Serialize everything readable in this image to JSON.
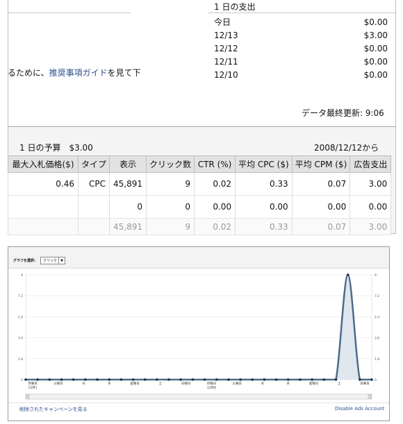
{
  "daily_spend": {
    "title": "1 日の支出",
    "rows": [
      {
        "label": "今日",
        "value": "$0.00"
      },
      {
        "label": "12/13",
        "value": "$3.00"
      },
      {
        "label": "12/12",
        "value": "$0.00"
      },
      {
        "label": "12/11",
        "value": "$0.00"
      },
      {
        "label": "12/10",
        "value": "$0.00"
      }
    ],
    "last_update": "データ最終更新: 9:06"
  },
  "notice": {
    "before": "るために、",
    "link": "推奨事項ガイド",
    "after": "を見て下"
  },
  "budget": {
    "label": "1 日の予算　$3.00",
    "start": "2008/12/12から"
  },
  "stats_table": {
    "headers": [
      "最大入札価格($)",
      "タイプ",
      "表示",
      "クリック数",
      "CTR (%)",
      "平均 CPC ($)",
      "平均 CPM ($)",
      "広告支出"
    ],
    "rows": [
      [
        "0.46",
        "CPC",
        "45,891",
        "9",
        "0.02",
        "0.33",
        "0.07",
        "3.00"
      ],
      [
        "",
        "",
        "0",
        "0",
        "0.00",
        "0.00",
        "0.00",
        "0.00"
      ]
    ],
    "total": [
      "",
      "",
      "45,891",
      "9",
      "0.02",
      "0.33",
      "0.07",
      "3.00"
    ]
  },
  "chart_panel": {
    "select_label": "グラフを選択:",
    "select_value": "クリック",
    "footer_left": "削除されたキャンペーンを見る",
    "footer_right": "Disable Ads Account"
  },
  "colors": {
    "line": "#4d6b89",
    "fill": "#dfe6ee",
    "link": "#2a4f8a"
  },
  "chart_data": {
    "type": "area",
    "y_ticks": [
      "0",
      "1.8",
      "3.6",
      "5.4",
      "7.2",
      "9"
    ],
    "ylim": [
      0,
      9
    ],
    "x_labels": [
      "月曜日",
      "火曜日",
      "水",
      "木",
      "金曜日",
      "土",
      "日曜日",
      "月曜日",
      "火曜日",
      "水",
      "木",
      "金曜日",
      "土",
      "日曜日"
    ],
    "x_sublabels": [
      "12月1",
      "",
      "",
      "",
      "",
      "",
      "",
      "12月8",
      "",
      "",
      "",
      "",
      "",
      ""
    ],
    "series": [
      {
        "values": [
          0,
          0,
          0,
          0,
          0,
          0,
          0,
          0,
          0,
          0,
          0,
          0,
          0,
          0,
          0,
          0,
          0,
          0,
          0,
          0,
          0,
          0,
          0,
          0,
          0,
          0,
          0,
          9,
          0,
          0
        ]
      }
    ],
    "grid": true
  }
}
